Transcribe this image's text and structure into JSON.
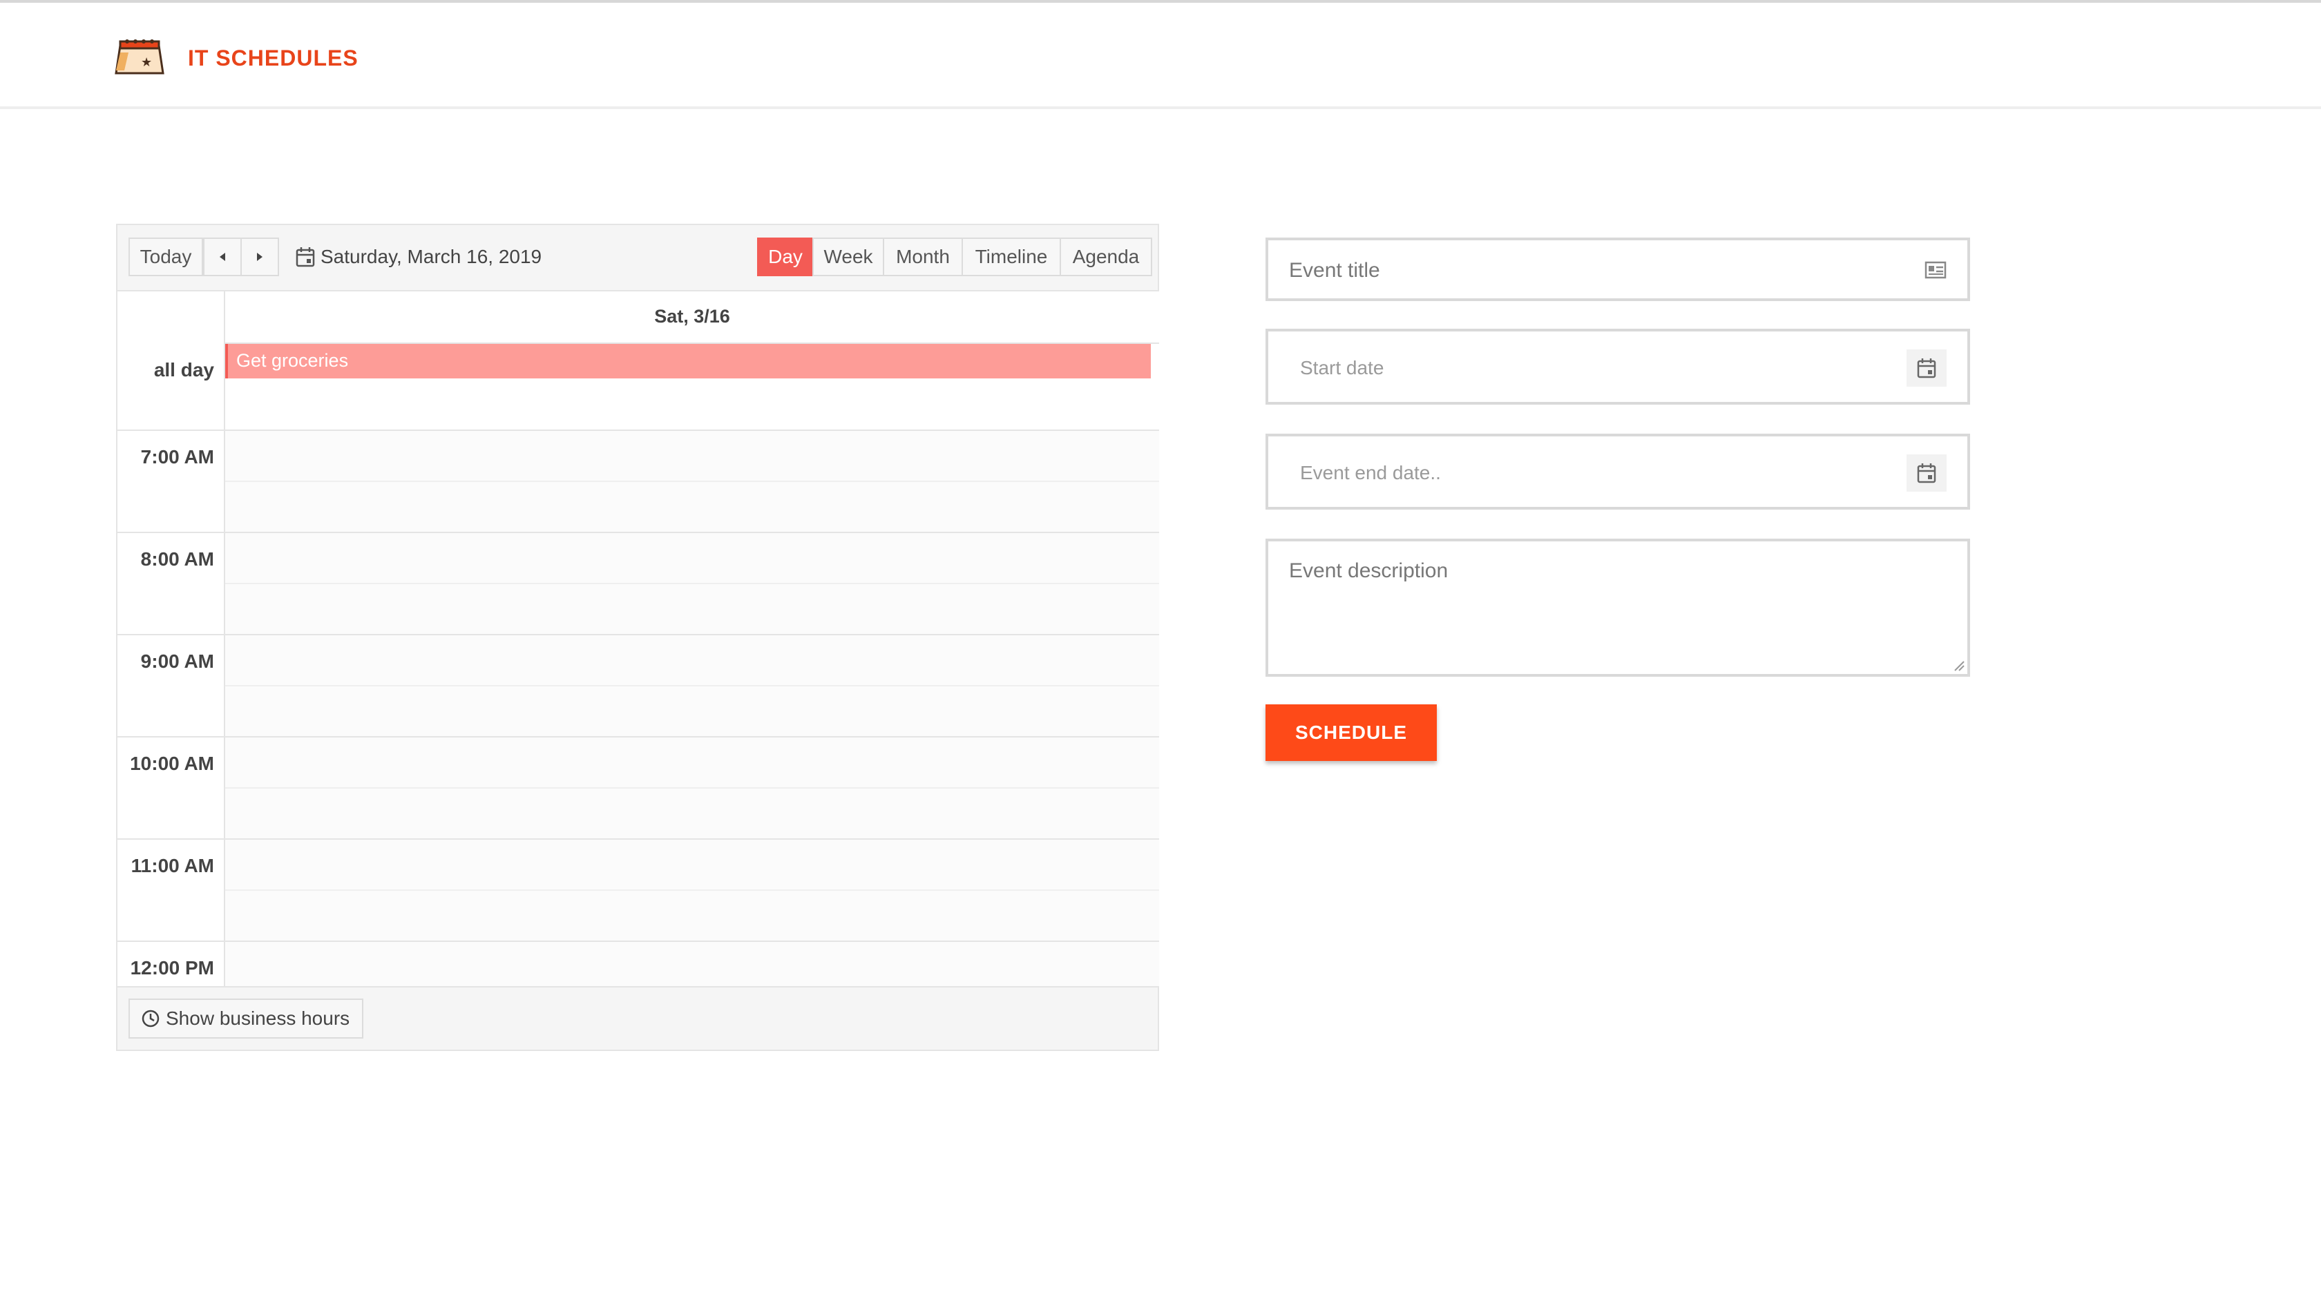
{
  "header": {
    "brand": "IT SCHEDULES",
    "logo_icon": "calendar-logo-icon"
  },
  "scheduler": {
    "toolbar": {
      "today_label": "Today",
      "prev_icon": "triangle-left-icon",
      "next_icon": "triangle-right-icon",
      "date_label": "Saturday, March 16, 2019",
      "views": [
        "Day",
        "Week",
        "Month",
        "Timeline",
        "Agenda"
      ],
      "active_view": "Day"
    },
    "day_header": "Sat, 3/16",
    "all_day_label": "all day",
    "all_day_event": "Get groceries",
    "hours": [
      "7:00 AM",
      "8:00 AM",
      "9:00 AM",
      "10:00 AM",
      "11:00 AM",
      "12:00 PM"
    ],
    "footer": {
      "business_hours_label": "Show business hours"
    },
    "colors": {
      "accent": "#f35b55",
      "event_bg": "#fd9c97"
    }
  },
  "form": {
    "title_placeholder": "Event title",
    "start_placeholder": "Start date",
    "end_placeholder": "Event end date..",
    "description_placeholder": "Event description",
    "submit_label": "SCHEDULE",
    "submit_color": "#fe4a18"
  }
}
